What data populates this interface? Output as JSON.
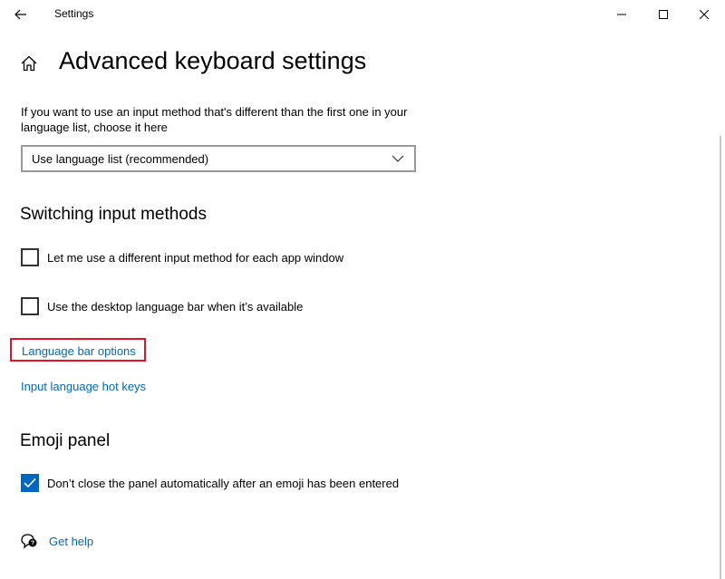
{
  "window": {
    "title": "Settings",
    "controls": [
      "minimize",
      "maximize",
      "close"
    ]
  },
  "page": {
    "title": "Advanced keyboard settings"
  },
  "input_method": {
    "description": "If you want to use an input method that's different than the first one in your language list, choose it here",
    "selected": "Use language list (recommended)"
  },
  "switching": {
    "heading": "Switching input methods",
    "options": [
      {
        "label": "Let me use a different input method for each app window",
        "checked": false
      },
      {
        "label": "Use the desktop language bar when it’s available",
        "checked": false
      }
    ],
    "links": {
      "language_bar": "Language bar options",
      "hot_keys": "Input language hot keys"
    }
  },
  "emoji": {
    "heading": "Emoji panel",
    "option": {
      "label": "Don’t close the panel automatically after an emoji has been entered",
      "checked": true
    }
  },
  "help": {
    "label": "Get help"
  },
  "colors": {
    "accent": "#0067c0",
    "highlight_border": "#e81123"
  }
}
